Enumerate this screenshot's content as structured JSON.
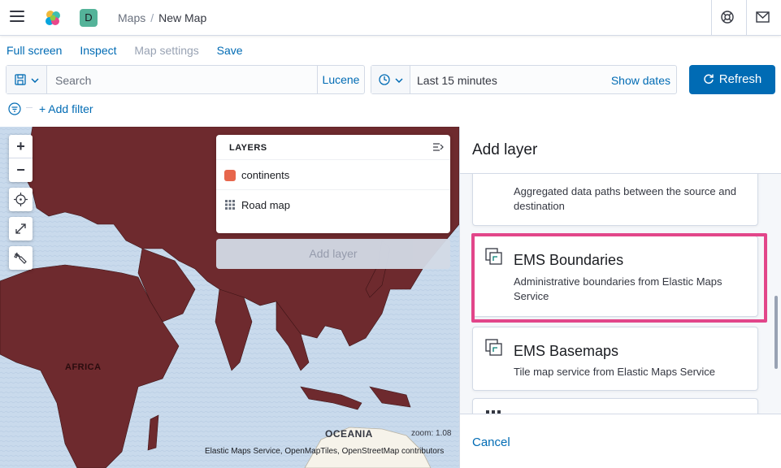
{
  "header": {
    "space_initial": "D",
    "breadcrumb_parent": "Maps",
    "breadcrumb_separator": "/",
    "breadcrumb_current": "New Map"
  },
  "app_menu": {
    "full_screen": "Full screen",
    "inspect": "Inspect",
    "map_settings": "Map settings",
    "save": "Save"
  },
  "query_bar": {
    "search_placeholder": "Search",
    "language": "Lucene"
  },
  "time_picker": {
    "range": "Last 15 minutes",
    "show_dates": "Show dates"
  },
  "refresh_label": "Refresh",
  "filter": {
    "add_filter": "+ Add filter"
  },
  "map": {
    "zoom_in": "+",
    "zoom_out": "−",
    "africa_label": "AFRICA",
    "oceania_label": "OCEANIA",
    "zoom_readout": "zoom: 1.08",
    "attribution": "Elastic Maps Service, OpenMapTiles, OpenStreetMap contributors"
  },
  "layers_panel": {
    "title": "LAYERS",
    "items": [
      {
        "label": "continents",
        "icon": "color-swatch"
      },
      {
        "label": "Road map",
        "icon": "grid-icon"
      }
    ],
    "add_layer_button": "Add layer"
  },
  "side_panel": {
    "title": "Add layer",
    "cards": [
      {
        "title": "",
        "description": "Aggregated data paths between the source and destination"
      },
      {
        "title": "EMS Boundaries",
        "description": "Administrative boundaries from Elastic Maps Service",
        "highlighted": true
      },
      {
        "title": "EMS Basemaps",
        "description": "Tile map service from Elastic Maps Service"
      }
    ],
    "cancel": "Cancel"
  },
  "colors": {
    "primary": "#006bb4",
    "map_land": "#6e2a2e",
    "map_water": "#c7d8ec",
    "highlight": "#e2468a",
    "layer_swatch": "#e7664c"
  }
}
